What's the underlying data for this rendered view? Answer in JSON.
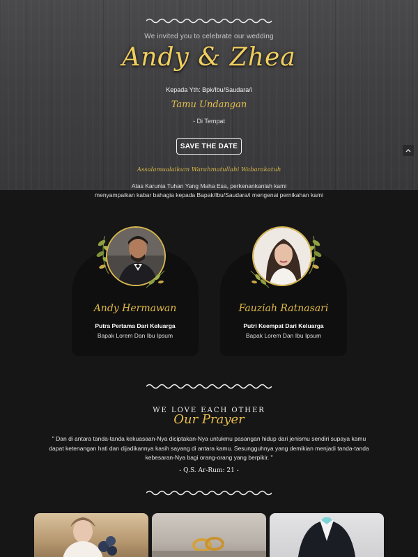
{
  "hero": {
    "invite_line": "We invited you to celebrate our wedding",
    "couple_title": "Andy & Zhea",
    "to_line": "Kepada Yth: Bpk/Ibu/Saudara/i",
    "guest_name": "Tamu Undangan",
    "place_line": "- Di Tempat",
    "save_button": "SAVE THE DATE",
    "salam": "Assalamualaikum Warahmatullahi Wabarakatuh",
    "scroll_top_icon": "chevron-up-icon"
  },
  "intro": {
    "line1": "Atas Karunia Tuhan Yang Maha Esa, perkenankanlah kami",
    "line2": "menyampaikan kabar bahagia kepada Bapak/Ibu/Saudara/i mengenai pernikahan kami"
  },
  "groom": {
    "name": "Andy Hermawan",
    "role": "Putra Pertama Dari Keluarga",
    "parents": "Bapak Lorem Dan Ibu Ipsum"
  },
  "bride": {
    "name": "Fauziah Ratnasari",
    "role": "Putri Keempat Dari Keluarga",
    "parents": "Bapak Lorem Dan Ibu Ipsum"
  },
  "prayer": {
    "kicker": "WE LOVE EACH OTHER",
    "title": "Our Prayer",
    "text": "\" Dan di antara tanda-tanda kekuasaan-Nya diciptakan-Nya untukmu pasangan hidup dari jenismu sendiri supaya kamu dapat ketenangan hati dan dijadikannya kasih sayang di antara kamu. Sesungguhnya yang demikian menjadi tanda-tanda kebesaran-Nya bagi orang-orang yang berpikir. \"",
    "source": "- Q.S. Ar-Rum: 21 -"
  },
  "colors": {
    "gold": "#e6bd4c",
    "background": "#161617",
    "card": "#0f0f10"
  }
}
